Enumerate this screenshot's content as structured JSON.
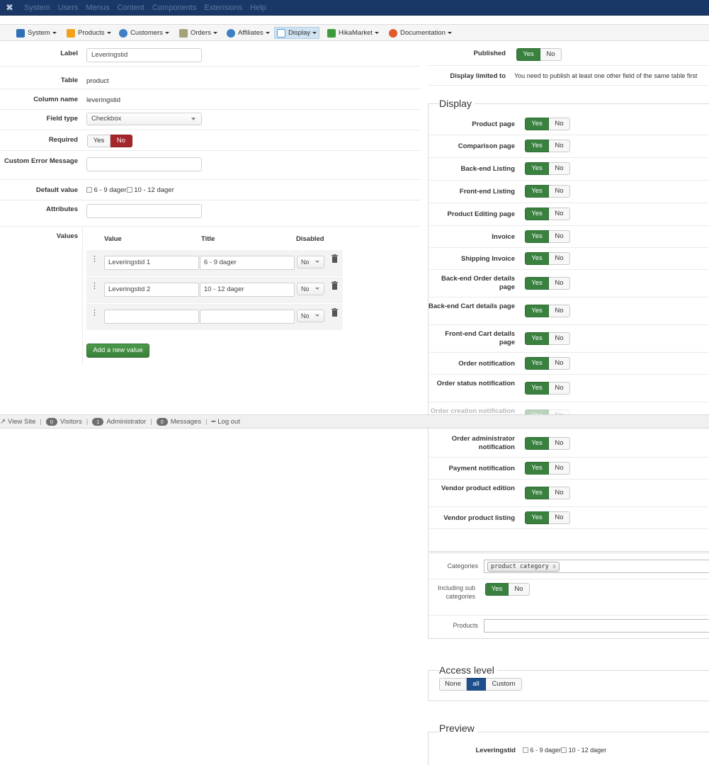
{
  "admin_menu": [
    "System",
    "Users",
    "Menus",
    "Content",
    "Components",
    "Extensions",
    "Help"
  ],
  "subnav": [
    {
      "label": "System",
      "icon": "wrench-icon",
      "color": "#2e6fb5"
    },
    {
      "label": "Products",
      "icon": "box-icon",
      "color": "#f2a21a"
    },
    {
      "label": "Customers",
      "icon": "users-icon",
      "color": "#3f7fc4"
    },
    {
      "label": "Orders",
      "icon": "cart-icon",
      "color": "#a3a375"
    },
    {
      "label": "Affiliates",
      "icon": "affiliate-icon",
      "color": "#3c7fc4"
    },
    {
      "label": "Display",
      "icon": "display-icon",
      "color": "#4d9ad6"
    },
    {
      "label": "HikaMarket",
      "icon": "market-icon",
      "color": "#3d9a3d"
    },
    {
      "label": "Documentation",
      "icon": "lifebuoy-icon",
      "color": "#e05a2b"
    }
  ],
  "form": {
    "label_label": "Label",
    "label_value": "Leveringstid",
    "table_label": "Table",
    "table_value": "product",
    "column_label": "Column name",
    "column_value": "leveringstid",
    "fieldtype_label": "Field type",
    "fieldtype_value": "Checkbox",
    "required_label": "Required",
    "yes": "Yes",
    "no": "No",
    "custom_error_label": "Custom Error Message",
    "default_label": "Default value",
    "default_opt1": "6 - 9 dager",
    "default_opt2": "10 - 12 dager",
    "attributes_label": "Attributes",
    "values_label": "Values",
    "col_value": "Value",
    "col_title": "Title",
    "col_disabled": "Disabled",
    "rows": [
      {
        "value": "Leveringstid 1",
        "title": "6 - 9 dager",
        "disabled": "No"
      },
      {
        "value": "Leveringstid 2",
        "title": "10 - 12 dager",
        "disabled": "No"
      },
      {
        "value": "",
        "title": "",
        "disabled": "No"
      }
    ],
    "add_button": "Add a new value"
  },
  "statusbar": {
    "view_site": "View Site",
    "visitors_count": "0",
    "visitors": "Visitors",
    "admin_count": "1",
    "admin": "Administrator",
    "messages_count": "0",
    "messages": "Messages",
    "logout": "Log out"
  },
  "right": {
    "published_label": "Published",
    "display_limited_label": "Display limited to",
    "display_limited_text": "You need to publish at least one other field of the same table first",
    "display_title": "Display",
    "display_rows": [
      "Product page",
      "Comparison page",
      "Back-end Listing",
      "Front-end Listing",
      "Product Editing page",
      "Invoice",
      "Shipping Invoice",
      "Back-end Order details page",
      "Back-end Cart details page",
      "Front-end Cart details page",
      "Order notification",
      "Order status notification",
      "Order creation notification",
      "Order administrator notification",
      "Payment notification",
      "Vendor product edition",
      "Vendor product listing"
    ],
    "categories_label": "Categories",
    "category_tag": "product category",
    "including_label": "Including sub categories",
    "products_label": "Products",
    "access_title": "Access level",
    "access_none": "None",
    "access_all": "all",
    "access_custom": "Custom",
    "preview_title": "Preview",
    "preview_label": "Leveringstid"
  }
}
